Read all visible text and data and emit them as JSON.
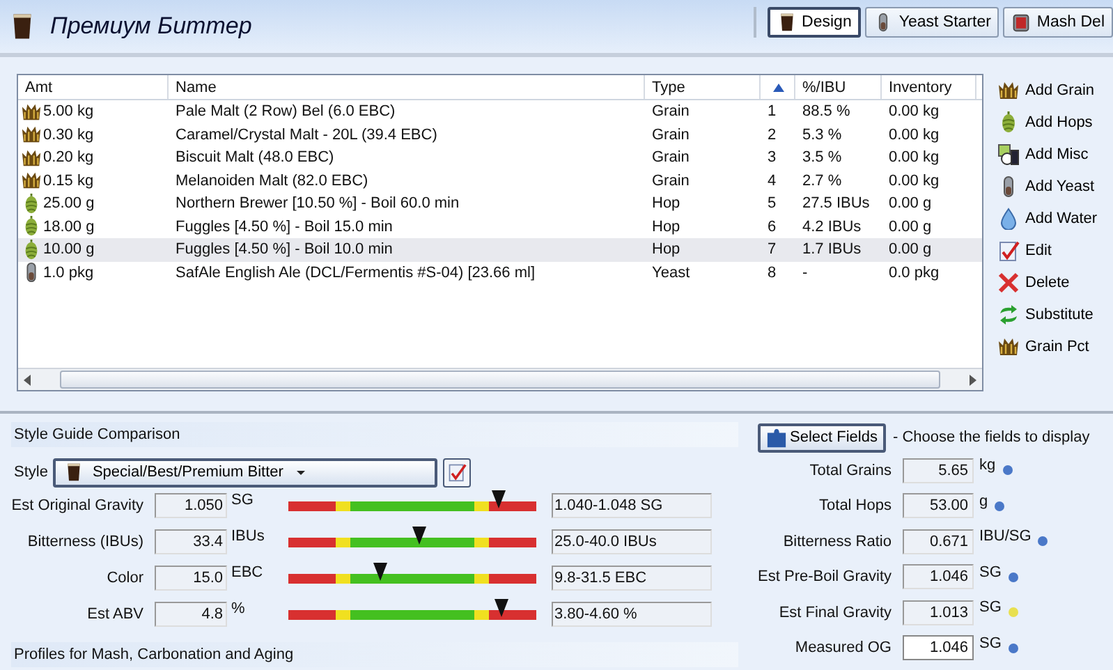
{
  "header": {
    "title": "Премиум Биттер",
    "tabs": [
      {
        "label": "Design",
        "kind": "pint",
        "selected": true
      },
      {
        "label": "Yeast Starter",
        "kind": "yeast",
        "selected": false
      },
      {
        "label": "Mash Del",
        "kind": "mash",
        "selected": false
      }
    ]
  },
  "ingredients": {
    "columns": [
      {
        "label": "Amt"
      },
      {
        "label": "Name"
      },
      {
        "label": "Type"
      },
      {
        "kind": "sort"
      },
      {
        "label": "%/IBU"
      },
      {
        "label": "Inventory"
      }
    ],
    "rows": [
      {
        "kind": "grain",
        "amt": "5.00 kg",
        "name": "Pale Malt (2 Row) Bel (6.0 EBC)",
        "type": "Grain",
        "order": "1",
        "pct_ibu": "88.5 %",
        "inventory": "0.00 kg",
        "selected": false
      },
      {
        "kind": "grain",
        "amt": "0.30 kg",
        "name": "Caramel/Crystal Malt - 20L (39.4 EBC)",
        "type": "Grain",
        "order": "2",
        "pct_ibu": "5.3 %",
        "inventory": "0.00 kg",
        "selected": false
      },
      {
        "kind": "grain",
        "amt": "0.20 kg",
        "name": "Biscuit Malt (48.0 EBC)",
        "type": "Grain",
        "order": "3",
        "pct_ibu": "3.5 %",
        "inventory": "0.00 kg",
        "selected": false
      },
      {
        "kind": "grain",
        "amt": "0.15 kg",
        "name": "Melanoiden Malt (82.0 EBC)",
        "type": "Grain",
        "order": "4",
        "pct_ibu": "2.7 %",
        "inventory": "0.00 kg",
        "selected": false
      },
      {
        "kind": "hop",
        "amt": "25.00 g",
        "name": "Northern Brewer [10.50 %] - Boil 60.0 min",
        "type": "Hop",
        "order": "5",
        "pct_ibu": "27.5 IBUs",
        "inventory": "0.00 g",
        "selected": false
      },
      {
        "kind": "hop",
        "amt": "18.00 g",
        "name": "Fuggles [4.50 %] - Boil 15.0 min",
        "type": "Hop",
        "order": "6",
        "pct_ibu": "4.2 IBUs",
        "inventory": "0.00 g",
        "selected": false
      },
      {
        "kind": "hop",
        "amt": "10.00 g",
        "name": "Fuggles [4.50 %] - Boil 10.0 min",
        "type": "Hop",
        "order": "7",
        "pct_ibu": "1.7 IBUs",
        "inventory": "0.00 g",
        "selected": true
      },
      {
        "kind": "yeast",
        "amt": "1.0 pkg",
        "name": "SafAle English Ale (DCL/Fermentis #S-04) [23.66 ml]",
        "type": "Yeast",
        "order": "8",
        "pct_ibu": "-",
        "inventory": "0.0 pkg",
        "selected": false
      }
    ]
  },
  "actions": [
    {
      "label": "Add Grain",
      "kind": "grain"
    },
    {
      "label": "Add Hops",
      "kind": "hop"
    },
    {
      "label": "Add Misc",
      "kind": "misc"
    },
    {
      "label": "Add Yeast",
      "kind": "yeast"
    },
    {
      "label": "Add Water",
      "kind": "water"
    },
    {
      "label": "Edit",
      "kind": "edit"
    },
    {
      "label": "Delete",
      "kind": "delete"
    },
    {
      "label": "Substitute",
      "kind": "substitute"
    },
    {
      "label": "Grain Pct",
      "kind": "grain"
    }
  ],
  "style_guide": {
    "title": "Style Guide Comparison",
    "style_label": "Style",
    "style_value": "Special/Best/Premium Bitter",
    "gauges": [
      {
        "label": "Est Original Gravity",
        "value": "1.050",
        "unit": "SG",
        "level": 0.85,
        "range": "1.040-1.048 SG"
      },
      {
        "label": "Bitterness (IBUs)",
        "value": "33.4",
        "unit": "IBUs",
        "level": 0.53,
        "range": "25.0-40.0 IBUs"
      },
      {
        "label": "Color",
        "value": "15.0",
        "unit": "EBC",
        "level": 0.37,
        "range": "9.8-31.5 EBC"
      },
      {
        "label": "Est ABV",
        "value": "4.8",
        "unit": "%",
        "level": 0.86,
        "range": "3.80-4.60 %"
      }
    ]
  },
  "profiles": {
    "title": "Profiles for Mash, Carbonation and Aging"
  },
  "stats": {
    "button": "Select Fields",
    "hint": "- Choose the fields to display",
    "fields": [
      {
        "label": "Total Grains",
        "value": "5.65",
        "unit": "kg",
        "color": "#4a78c8",
        "editable": false
      },
      {
        "label": "Total Hops",
        "value": "53.00",
        "unit": "g",
        "color": "#4a78c8",
        "editable": false
      },
      {
        "label": "Bitterness Ratio",
        "value": "0.671",
        "unit": "IBU/SG",
        "color": "#4a78c8",
        "editable": false
      },
      {
        "label": "Est Pre-Boil Gravity",
        "value": "1.046",
        "unit": "SG",
        "color": "#4a78c8",
        "editable": false
      },
      {
        "label": "Est Final Gravity",
        "value": "1.013",
        "unit": "SG",
        "color": "#e8e050",
        "editable": false
      },
      {
        "label": "Measured OG",
        "value": "1.046",
        "unit": "SG",
        "color": "#4a78c8",
        "editable": true
      }
    ]
  }
}
